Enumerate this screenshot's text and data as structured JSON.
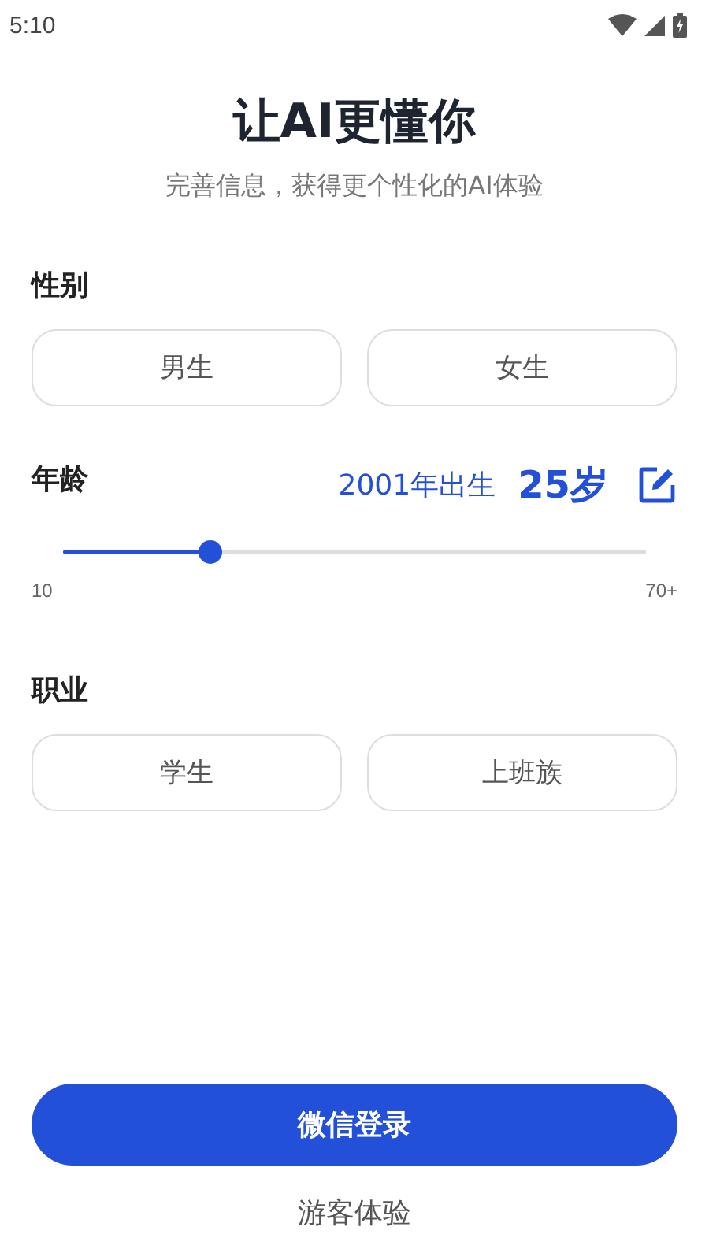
{
  "status_bar": {
    "time": "5:10"
  },
  "title": "让AI更懂你",
  "subtitle": "完善信息，获得更个性化的AI体验",
  "gender": {
    "label": "性别",
    "options": [
      {
        "label": "男生",
        "selected": false
      },
      {
        "label": "女生",
        "selected": false
      }
    ]
  },
  "age": {
    "label": "年龄",
    "birth_year": "2001年出生",
    "value": "25岁",
    "level": 0.25,
    "min_label": "10",
    "max_label": "70+"
  },
  "occupation": {
    "label": "职业",
    "options": [
      {
        "label": "学生",
        "selected": false
      },
      {
        "label": "上班族",
        "selected": false
      }
    ]
  },
  "login_button": "微信登录",
  "guest_link": "游客体验"
}
